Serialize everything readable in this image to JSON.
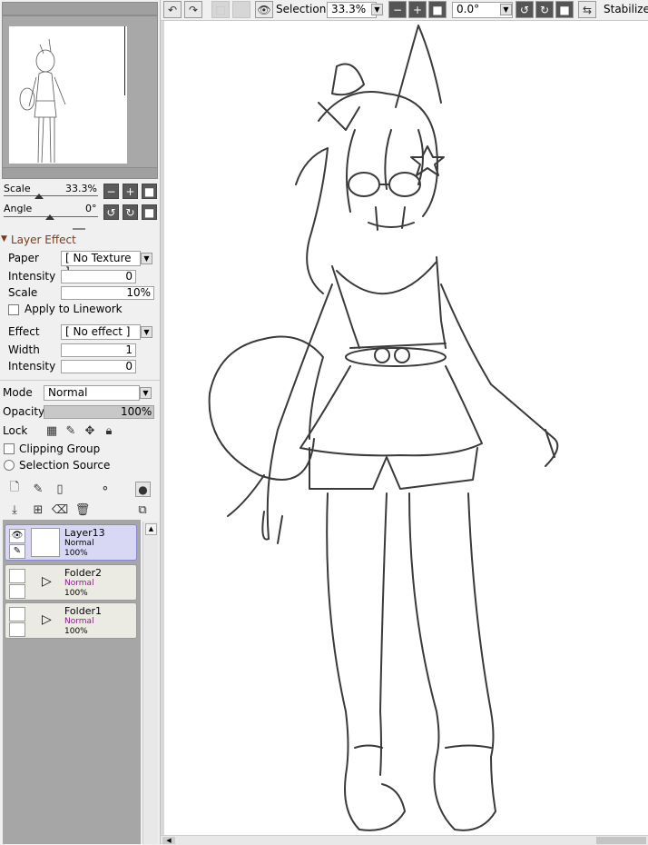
{
  "navigator": {
    "scale_label": "Scale",
    "scale_value": "33.3%",
    "angle_label": "Angle",
    "angle_value": "0°"
  },
  "layer_effect": {
    "title": "Layer Effect",
    "paper_label": "Paper",
    "paper_value": "[ No Texture ]",
    "intensity_label": "Intensity",
    "intensity_value": "0",
    "scale_label": "Scale",
    "scale_value": "10%",
    "apply_linework_label": "Apply to Linework",
    "effect_label": "Effect",
    "effect_value": "[ No effect ]",
    "width_label": "Width",
    "width_value": "1",
    "intensity2_label": "Intensity",
    "intensity2_value": "0"
  },
  "layer_props": {
    "mode_label": "Mode",
    "mode_value": "Normal",
    "opacity_label": "Opacity",
    "opacity_value": "100%",
    "opacity_fraction": 1.0,
    "lock_label": "Lock",
    "clipping_group_label": "Clipping Group",
    "selection_source_label": "Selection Source"
  },
  "layers": [
    {
      "name": "Layer13",
      "mode": "Normal",
      "opacity": "100%",
      "selected": true,
      "type": "layer"
    },
    {
      "name": "Folder2",
      "mode": "Normal",
      "opacity": "100%",
      "selected": false,
      "type": "folder"
    },
    {
      "name": "Folder1",
      "mode": "Normal",
      "opacity": "100%",
      "selected": false,
      "type": "folder"
    }
  ],
  "toolbar": {
    "selection_label": "Selection",
    "zoom_value": "33.3%",
    "rotation_value": "0.0°",
    "stabilizer_label": "Stabilizer"
  },
  "colors": {
    "panel_bg": "#f0f0f0",
    "selected_layer": "#d8d8f4",
    "folder_mode_color": "#8b1a8b",
    "section_title": "#7a3b1b"
  }
}
